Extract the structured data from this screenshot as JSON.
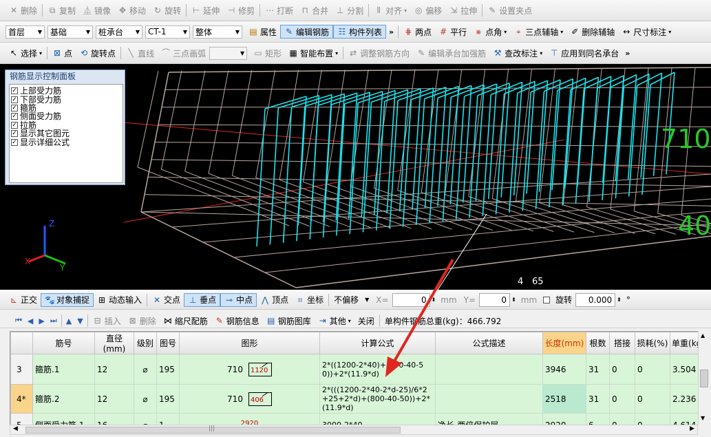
{
  "toolbar1": [
    {
      "label": "删除",
      "icon": "x",
      "disabled": true
    },
    {
      "label": "复制",
      "icon": "copy",
      "disabled": true
    },
    {
      "label": "镜像",
      "icon": "mirror",
      "disabled": true
    },
    {
      "label": "移动",
      "icon": "move",
      "disabled": true
    },
    {
      "label": "旋转",
      "icon": "rotate",
      "disabled": true
    },
    {
      "label": "延伸",
      "icon": "extend",
      "disabled": true
    },
    {
      "label": "修剪",
      "icon": "trim",
      "disabled": true
    },
    {
      "label": "打断",
      "icon": "break",
      "disabled": true
    },
    {
      "label": "合并",
      "icon": "merge",
      "disabled": true
    },
    {
      "label": "分割",
      "icon": "split",
      "disabled": true
    },
    {
      "label": "对齐",
      "icon": "align",
      "disabled": true
    },
    {
      "label": "偏移",
      "icon": "offset",
      "disabled": true
    },
    {
      "label": "拉伸",
      "icon": "stretch",
      "disabled": true
    },
    {
      "label": "设置夹点",
      "icon": "grip",
      "disabled": true
    }
  ],
  "toolbar2": {
    "selects": [
      {
        "value": "首层"
      },
      {
        "value": "基础"
      },
      {
        "value": "桩承台"
      },
      {
        "value": "CT-1"
      },
      {
        "value": "整体"
      }
    ],
    "buttons": [
      "属性",
      "编辑钢筋",
      "构件列表"
    ],
    "right": [
      "两点",
      "平行",
      "点角",
      "三点辅轴",
      "删除辅轴",
      "尺寸标注"
    ]
  },
  "toolbar3": {
    "items": [
      "选择",
      "点",
      "旋转点",
      "直线",
      "三点画弧"
    ],
    "items2": [
      "矩形",
      "智能布置",
      "调整钢筋方向",
      "编辑承台加强筋",
      "查改标注",
      "应用到同名承台"
    ]
  },
  "panel": {
    "title": "钢筋显示控制面板",
    "items": [
      "上部受力筋",
      "下部受力筋",
      "箍筋",
      "侧面受力筋",
      "拉筋",
      "显示其它图元",
      "显示详细公式"
    ]
  },
  "viewport": {
    "labels": [
      "710",
      "40",
      "4",
      "65"
    ],
    "axis": [
      "Z",
      "X",
      "Y"
    ]
  },
  "snapbar": {
    "items": [
      "正交",
      "对象捕捉",
      "动态输入",
      "交点",
      "垂点",
      "中点",
      "顶点",
      "坐标"
    ],
    "offset": "不偏移",
    "x_label": "X=",
    "x_value": "0",
    "y_label": "Y=",
    "y_value": "0",
    "unit": "mm",
    "rotate": "旋转",
    "angle": "0.000",
    "deg": "°"
  },
  "gridbar": {
    "items": [
      "插入",
      "删除",
      "缩尺配筋",
      "钢筋信息",
      "钢筋图库",
      "其他",
      "关闭"
    ],
    "total": "单构件钢筋总重(kg)：466.792"
  },
  "table": {
    "headers": [
      "",
      "筋号",
      "直径(mm)",
      "级别",
      "图号",
      "图形",
      "计算公式",
      "公式描述",
      "长度(mm)",
      "根数",
      "搭接",
      "损耗(%)",
      "单重(kg)"
    ],
    "rows": [
      {
        "num": "3",
        "name": "箍筋.1",
        "dia": "12",
        "grade": "⌀",
        "fig": "195",
        "shape_a": "710",
        "shape_b": "1120",
        "formula": "2*((1200-2*40)+(800-40-50))+2*(11.9*d)",
        "desc": "",
        "len": "3946",
        "count": "31",
        "lap": "0",
        "loss": "0",
        "wt": "3.504"
      },
      {
        "num": "4*",
        "name": "箍筋.2",
        "dia": "12",
        "grade": "⌀",
        "fig": "195",
        "shape_a": "710",
        "shape_b": "406",
        "formula": "2*(((1200-2*40-2*d-25)/6*2+25+2*d)+(800-40-50))+2*(11.9*d)",
        "desc": "",
        "len": "2518",
        "count": "31",
        "lap": "0",
        "loss": "0",
        "wt": "2.236"
      },
      {
        "num": "5",
        "name": "侧面受力筋.1",
        "dia": "16",
        "grade": "⌀",
        "fig": "1",
        "shape_a": "",
        "shape_b": "2920",
        "formula": "3000-2*40",
        "desc": "净长-两倍保护层",
        "len": "2920",
        "count": "6",
        "lap": "0",
        "loss": "0",
        "wt": "4.614"
      }
    ]
  },
  "colors": {
    "cyan": "#19e6f0",
    "frame": "#b8a6a0",
    "green": "#29c729",
    "red": "#e0261f"
  }
}
